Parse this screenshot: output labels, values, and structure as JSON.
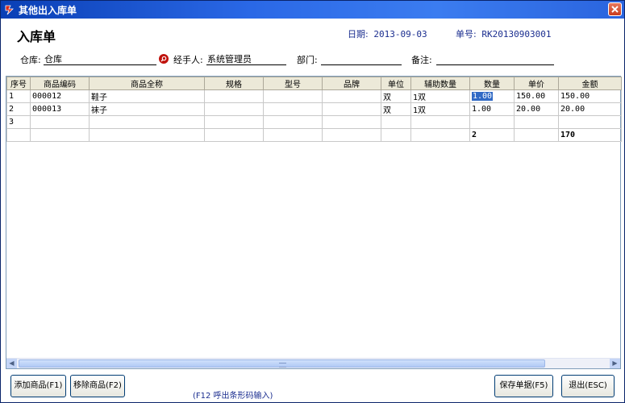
{
  "window": {
    "title": "其他出入库单"
  },
  "form": {
    "heading": "入库单",
    "date_label": "日期:",
    "date_value": "2013-09-03",
    "order_label": "单号:",
    "order_value": "RK20130903001",
    "warehouse_label": "仓库:",
    "warehouse_value": "仓库",
    "handler_label": "经手人:",
    "handler_value": "系统管理员",
    "dept_label": "部门:",
    "dept_value": "",
    "remark_label": "备注:",
    "remark_value": ""
  },
  "grid": {
    "columns": [
      "序号",
      "商品编码",
      "商品全称",
      "规格",
      "型号",
      "品牌",
      "单位",
      "辅助数量",
      "数量",
      "单价",
      "金额"
    ],
    "rows": [
      [
        "1",
        "000012",
        "鞋子",
        "",
        "",
        "",
        "双",
        "1双",
        "1.00",
        "150.00",
        "150.00"
      ],
      [
        "2",
        "000013",
        "袜子",
        "",
        "",
        "",
        "双",
        "1双",
        "1.00",
        "20.00",
        "20.00"
      ],
      [
        "3",
        "",
        "",
        "",
        "",
        "",
        "",
        "",
        "",
        "",
        ""
      ]
    ],
    "totals": {
      "qty": "2",
      "amount": "170"
    }
  },
  "buttons": {
    "add": "添加商品(F1)",
    "remove": "移除商品(F2)",
    "save": "保存单据(F5)",
    "exit": "退出(ESC)"
  },
  "hint": "(F12 呼出条形码输入)",
  "icons": {
    "app": "app-icon",
    "close": "close-icon",
    "lookup": "magnifier-icon"
  },
  "colors": {
    "titlebar": "#2a68e6",
    "selection": "#316ac5",
    "meta_text": "#1a2d8f"
  }
}
